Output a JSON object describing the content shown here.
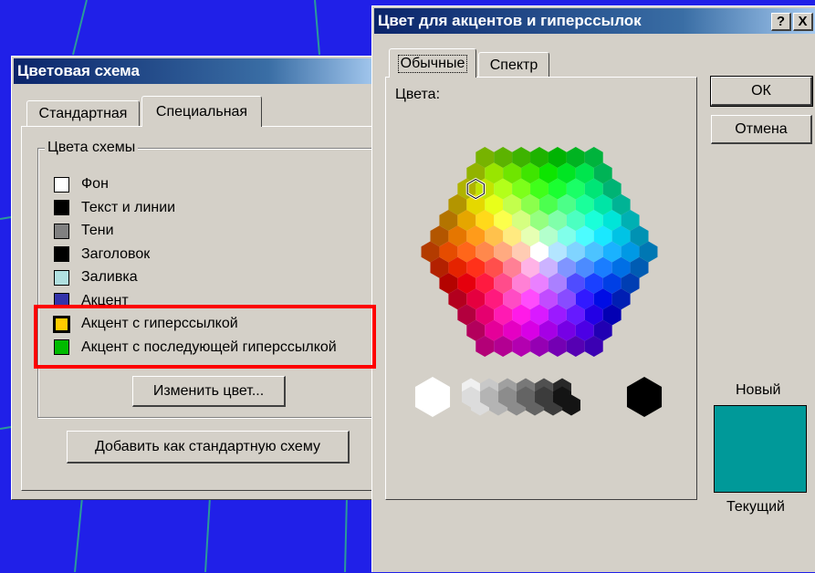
{
  "scheme_dialog": {
    "title": "Цветовая схема",
    "tabs": [
      "Стандартная",
      "Специальная"
    ],
    "group_title": "Цвета схемы",
    "items": [
      {
        "label": "Фон",
        "color": "#ffffff"
      },
      {
        "label": "Текст и линии",
        "color": "#000000"
      },
      {
        "label": "Тени",
        "color": "#808080"
      },
      {
        "label": "Заголовок",
        "color": "#000000"
      },
      {
        "label": "Заливка",
        "color": "#b0e0e0"
      },
      {
        "label": "Акцент",
        "color": "#3333aa"
      },
      {
        "label": "Акцент с гиперссылкой",
        "color": "#ffcc00"
      },
      {
        "label": "Акцент с последующей гиперссылкой",
        "color": "#00bb00"
      }
    ],
    "change_color_button": "Изменить цвет...",
    "add_standard_button": "Добавить как стандартную схему"
  },
  "color_dialog": {
    "title": "Цвет для акцентов и гиперссылок",
    "title_buttons": [
      "?",
      "X"
    ],
    "tabs": [
      "Обычные",
      "Спектр"
    ],
    "colors_label": "Цвета:",
    "ok_button": "ОК",
    "cancel_button": "Отмена",
    "new_label": "Новый",
    "current_label": "Текущий",
    "new_color": "#009999",
    "highlight_color": "#ff0000"
  }
}
